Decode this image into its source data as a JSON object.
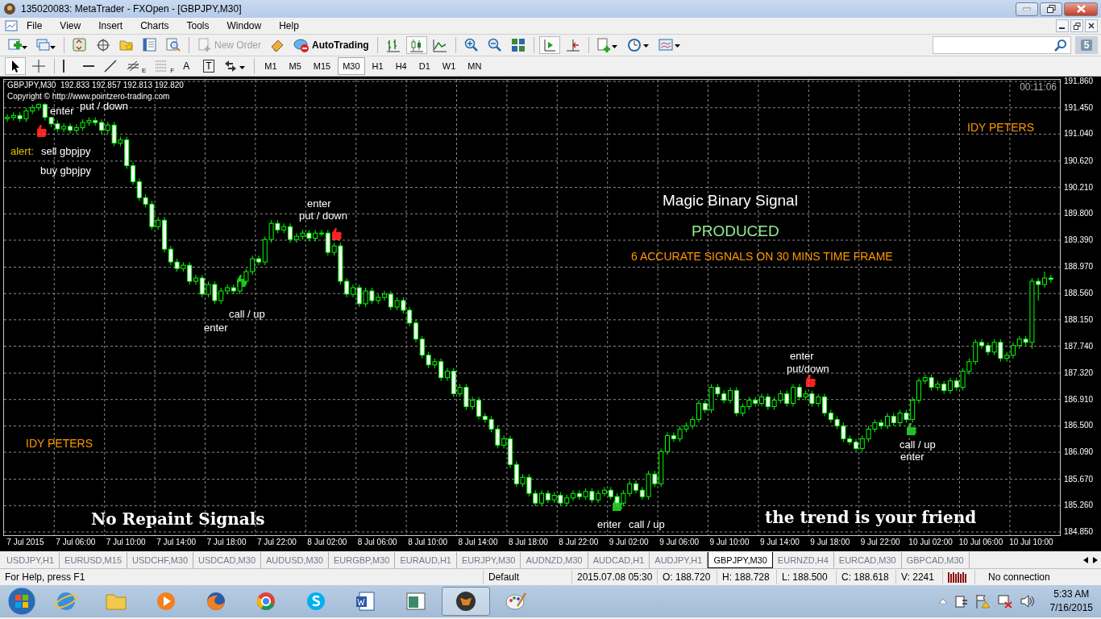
{
  "window": {
    "title": "135020083: MetaTrader - FXOpen - [GBPJPY,M30]"
  },
  "menu": [
    "File",
    "View",
    "Insert",
    "Charts",
    "Tools",
    "Window",
    "Help"
  ],
  "toolbar_1": [
    {
      "kind": "new-chart"
    },
    {
      "kind": "profiles"
    },
    {
      "kind": "separator"
    },
    {
      "kind": "market-watch"
    },
    {
      "kind": "navigator"
    },
    {
      "kind": "favorites"
    },
    {
      "kind": "terminal"
    },
    {
      "kind": "tester"
    },
    {
      "kind": "separator"
    },
    {
      "kind": "new-order",
      "label": "New Order",
      "disabled": true
    },
    {
      "kind": "editor"
    },
    {
      "kind": "autotrading",
      "label": "AutoTrading",
      "disabled": false
    },
    {
      "kind": "separator"
    },
    {
      "kind": "bar-chart",
      "selected": false
    },
    {
      "kind": "candles",
      "selected": true
    },
    {
      "kind": "line-chart",
      "selected": false
    },
    {
      "kind": "separator"
    },
    {
      "kind": "zoom-in"
    },
    {
      "kind": "zoom-out"
    },
    {
      "kind": "tile"
    },
    {
      "kind": "separator"
    },
    {
      "kind": "auto-scroll",
      "selected": true
    },
    {
      "kind": "chart-shift",
      "selected": false
    },
    {
      "kind": "separator"
    },
    {
      "kind": "indicators"
    },
    {
      "kind": "periods"
    },
    {
      "kind": "templates"
    }
  ],
  "messages_badge": "5",
  "toolbar_2": [
    {
      "kind": "cursor",
      "selected": true
    },
    {
      "kind": "crosshair",
      "selected": false
    },
    {
      "kind": "separator"
    },
    {
      "kind": "vline",
      "selected": false
    },
    {
      "kind": "hline",
      "selected": false
    },
    {
      "kind": "trendline",
      "selected": false
    },
    {
      "kind": "fib-channel",
      "label": "E",
      "selected": false
    },
    {
      "kind": "fib",
      "label": "F",
      "selected": false
    },
    {
      "kind": "text",
      "label": "A",
      "selected": false
    },
    {
      "kind": "label",
      "label": "T",
      "selected": false
    },
    {
      "kind": "arrows",
      "selected": false
    }
  ],
  "periods": [
    {
      "label": "M1",
      "selected": false
    },
    {
      "label": "M5",
      "selected": false
    },
    {
      "label": "M15",
      "selected": false
    },
    {
      "label": "M30",
      "selected": true
    },
    {
      "label": "H1",
      "selected": false
    },
    {
      "label": "H4",
      "selected": false
    },
    {
      "label": "D1",
      "selected": false
    },
    {
      "label": "W1",
      "selected": false
    },
    {
      "label": "MN",
      "selected": false
    }
  ],
  "chart": {
    "header": "GBPJPY,M30  192.833 192.857 192.813 192.820",
    "copyright": "Copyright © http://www.pointzero-trading.com",
    "timer": "00:11:06",
    "annotations": [
      {
        "text": "enter",
        "kind": "note"
      },
      {
        "text": "put / down",
        "kind": "note"
      },
      {
        "text": "alert:",
        "kind": "alert"
      },
      {
        "text": "sell gbpjpy",
        "kind": "note"
      },
      {
        "text": "buy gbpjpy",
        "kind": "note"
      },
      {
        "text": "IDY PETERS",
        "kind": "brand"
      },
      {
        "text": "Magic Binary Signal",
        "kind": "title"
      },
      {
        "text": "PRODUCED",
        "kind": "subtitle"
      },
      {
        "text": "6 ACCURATE SIGNALS ON 30 MINS TIME FRAME",
        "kind": "banner"
      },
      {
        "text": "enter",
        "kind": "note"
      },
      {
        "text": "put / down",
        "kind": "note"
      },
      {
        "text": "call / up",
        "kind": "note"
      },
      {
        "text": "enter",
        "kind": "note"
      },
      {
        "text": "enter",
        "kind": "note"
      },
      {
        "text": "put/down",
        "kind": "note"
      },
      {
        "text": "call / up",
        "kind": "note"
      },
      {
        "text": "enter",
        "kind": "note"
      },
      {
        "text": "IDY PETERS",
        "kind": "brand"
      },
      {
        "text": "No Repaint Signals",
        "kind": "slogan"
      },
      {
        "text": "enter",
        "kind": "note"
      },
      {
        "text": "call / up",
        "kind": "note"
      },
      {
        "text": "the trend is your friend",
        "kind": "slogan"
      }
    ],
    "markers": [
      {
        "color": "#ff2020"
      },
      {
        "color": "#ff2020"
      },
      {
        "color": "#ff2020"
      },
      {
        "color": "#20c020"
      },
      {
        "color": "#20c020"
      },
      {
        "color": "#20c020"
      }
    ],
    "chart_data": {
      "type": "candlestick",
      "grid": true,
      "ylim": [
        184.85,
        191.86
      ],
      "categories": [
        null,
        null,
        null,
        "7 Jul 2015",
        null,
        null,
        null,
        null,
        null,
        null,
        null,
        "7 Jul 06:00",
        null,
        null,
        null,
        null,
        null,
        null,
        null,
        "7 Jul 10:00",
        null,
        null,
        null,
        null,
        null,
        null,
        null,
        "7 Jul 14:00",
        null,
        null,
        null,
        null,
        null,
        null,
        null,
        "7 Jul 18:00",
        null,
        null,
        null,
        null,
        null,
        null,
        null,
        "7 Jul 22:00",
        null,
        null,
        null,
        null,
        null,
        null,
        null,
        "8 Jul 02:00",
        null,
        null,
        null,
        null,
        null,
        null,
        null,
        "8 Jul 06:00",
        null,
        null,
        null,
        null,
        null,
        null,
        null,
        "8 Jul 10:00",
        null,
        null,
        null,
        null,
        null,
        null,
        null,
        "8 Jul 14:00",
        null,
        null,
        null,
        null,
        null,
        null,
        null,
        "8 Jul 18:00",
        null,
        null,
        null,
        null,
        null,
        null,
        null,
        "8 Jul 22:00",
        null,
        null,
        null,
        null,
        null,
        null,
        null,
        "9 Jul 02:00",
        null,
        null,
        null,
        null,
        null,
        null,
        null,
        "9 Jul 06:00",
        null,
        null,
        null,
        null,
        null,
        null,
        null,
        "9 Jul 10:00",
        null,
        null,
        null,
        null,
        null,
        null,
        null,
        "9 Jul 14:00",
        null,
        null,
        null,
        null,
        null,
        null,
        null,
        "9 Jul 18:00",
        null,
        null,
        null,
        null,
        null,
        null,
        null,
        "9 Jul 22:00",
        null,
        null,
        null,
        null,
        null,
        null,
        null,
        "10 Jul 02:00",
        null,
        null,
        null,
        null,
        null,
        null,
        null,
        "10 Jul 06:00",
        null,
        null,
        null,
        null,
        null,
        null,
        null,
        "10 Jul 10:00",
        null,
        null,
        null
      ],
      "yticks": [
        {
          "value": 191.86,
          "label": "191.860"
        },
        {
          "value": 191.45,
          "label": "191.450"
        },
        {
          "value": 191.04,
          "label": "191.040"
        },
        {
          "value": 190.62,
          "label": "190.620"
        },
        {
          "value": 190.21,
          "label": "190.210"
        },
        {
          "value": 189.8,
          "label": "189.800"
        },
        {
          "value": 189.39,
          "label": "189.390"
        },
        {
          "value": 188.97,
          "label": "188.970"
        },
        {
          "value": 188.56,
          "label": "188.560"
        },
        {
          "value": 188.15,
          "label": "188.150"
        },
        {
          "value": 187.74,
          "label": "187.740"
        },
        {
          "value": 187.32,
          "label": "187.320"
        },
        {
          "value": 186.91,
          "label": "186.910"
        },
        {
          "value": 186.5,
          "label": "186.500"
        },
        {
          "value": 186.09,
          "label": "186.090"
        },
        {
          "value": 185.67,
          "label": "185.670"
        },
        {
          "value": 185.26,
          "label": "185.260"
        },
        {
          "value": 184.85,
          "label": "184.850"
        }
      ],
      "ohlc": [
        [
          191.28,
          191.35,
          191.23,
          191.3
        ],
        [
          191.3,
          191.38,
          191.25,
          191.33
        ],
        [
          191.33,
          191.38,
          191.23,
          191.28
        ],
        [
          191.28,
          191.45,
          191.23,
          191.4
        ],
        [
          191.4,
          191.5,
          191.35,
          191.45
        ],
        [
          191.45,
          191.52,
          191.4,
          191.5
        ],
        [
          191.5,
          191.52,
          191.25,
          191.3
        ],
        [
          191.3,
          191.3,
          191.15,
          191.2
        ],
        [
          191.2,
          191.25,
          191.07,
          191.12
        ],
        [
          191.12,
          191.21,
          191.07,
          191.16
        ],
        [
          191.16,
          191.21,
          191.05,
          191.1
        ],
        [
          191.1,
          191.19,
          191.05,
          191.14
        ],
        [
          191.14,
          191.27,
          191.09,
          191.22
        ],
        [
          191.22,
          191.3,
          191.17,
          191.25
        ],
        [
          191.25,
          191.3,
          191.17,
          191.22
        ],
        [
          191.22,
          191.27,
          191.05,
          191.1
        ],
        [
          191.1,
          191.23,
          191.05,
          191.18
        ],
        [
          191.18,
          191.23,
          190.85,
          190.9
        ],
        [
          190.9,
          191.0,
          190.85,
          190.95
        ],
        [
          190.95,
          191.0,
          190.5,
          190.55
        ],
        [
          190.55,
          190.6,
          190.25,
          190.3
        ],
        [
          190.3,
          190.35,
          190.0,
          190.05
        ],
        [
          190.05,
          190.1,
          189.9,
          189.95
        ],
        [
          189.95,
          190.0,
          189.55,
          189.6
        ],
        [
          189.6,
          189.75,
          189.55,
          189.7
        ],
        [
          189.7,
          189.75,
          189.2,
          189.25
        ],
        [
          189.25,
          189.3,
          189.0,
          189.05
        ],
        [
          189.05,
          189.1,
          188.9,
          188.95
        ],
        [
          188.95,
          189.05,
          188.9,
          189.0
        ],
        [
          189.0,
          189.05,
          188.7,
          188.75
        ],
        [
          188.75,
          188.85,
          188.7,
          188.8
        ],
        [
          188.8,
          188.85,
          188.5,
          188.55
        ],
        [
          188.55,
          188.75,
          188.5,
          188.7
        ],
        [
          188.7,
          188.75,
          188.4,
          188.45
        ],
        [
          188.45,
          188.65,
          188.4,
          188.6
        ],
        [
          188.6,
          188.7,
          188.55,
          188.65
        ],
        [
          188.65,
          188.7,
          188.55,
          188.6
        ],
        [
          188.6,
          188.8,
          188.55,
          188.75
        ],
        [
          188.75,
          188.95,
          188.7,
          188.9
        ],
        [
          188.9,
          189.15,
          188.85,
          189.1
        ],
        [
          189.1,
          189.15,
          189.0,
          189.05
        ],
        [
          189.05,
          189.45,
          189.0,
          189.4
        ],
        [
          189.4,
          189.7,
          189.35,
          189.65
        ],
        [
          189.65,
          189.7,
          189.5,
          189.55
        ],
        [
          189.55,
          189.65,
          189.5,
          189.6
        ],
        [
          189.6,
          189.65,
          189.35,
          189.4
        ],
        [
          189.4,
          189.5,
          189.35,
          189.45
        ],
        [
          189.45,
          189.55,
          189.4,
          189.5
        ],
        [
          189.5,
          189.55,
          189.37,
          189.42
        ],
        [
          189.42,
          189.55,
          189.37,
          189.5
        ],
        [
          189.5,
          189.55,
          189.45,
          189.5
        ],
        [
          189.5,
          189.55,
          189.15,
          189.2
        ],
        [
          189.2,
          189.35,
          189.15,
          189.3
        ],
        [
          189.3,
          189.35,
          188.7,
          188.75
        ],
        [
          188.75,
          188.8,
          188.5,
          188.55
        ],
        [
          188.55,
          188.7,
          188.5,
          188.65
        ],
        [
          188.65,
          188.7,
          188.35,
          188.4
        ],
        [
          188.4,
          188.65,
          188.35,
          188.6
        ],
        [
          188.6,
          188.65,
          188.4,
          188.45
        ],
        [
          188.45,
          188.55,
          188.4,
          188.5
        ],
        [
          188.5,
          188.6,
          188.45,
          188.55
        ],
        [
          188.55,
          188.6,
          188.3,
          188.35
        ],
        [
          188.35,
          188.5,
          188.3,
          188.45
        ],
        [
          188.45,
          188.5,
          188.25,
          188.3
        ],
        [
          188.3,
          188.35,
          188.05,
          188.1
        ],
        [
          188.1,
          188.15,
          187.8,
          187.85
        ],
        [
          187.85,
          187.9,
          187.55,
          187.6
        ],
        [
          187.6,
          187.65,
          187.4,
          187.45
        ],
        [
          187.45,
          187.55,
          187.4,
          187.5
        ],
        [
          187.5,
          187.55,
          187.2,
          187.25
        ],
        [
          187.25,
          187.4,
          187.2,
          187.35
        ],
        [
          187.35,
          187.4,
          186.95,
          187.0
        ],
        [
          187.0,
          187.15,
          186.95,
          187.1
        ],
        [
          187.1,
          187.15,
          186.75,
          186.8
        ],
        [
          186.8,
          186.95,
          186.75,
          186.9
        ],
        [
          186.9,
          186.95,
          186.6,
          186.65
        ],
        [
          186.65,
          186.7,
          186.55,
          186.6
        ],
        [
          186.6,
          186.65,
          186.4,
          186.45
        ],
        [
          186.45,
          186.5,
          186.15,
          186.2
        ],
        [
          186.2,
          186.35,
          186.15,
          186.3
        ],
        [
          186.3,
          186.35,
          185.85,
          185.9
        ],
        [
          185.9,
          185.95,
          185.55,
          185.6
        ],
        [
          185.6,
          185.75,
          185.55,
          185.7
        ],
        [
          185.7,
          185.75,
          185.4,
          185.45
        ],
        [
          185.45,
          185.5,
          185.25,
          185.3
        ],
        [
          185.3,
          185.5,
          185.25,
          185.45
        ],
        [
          185.45,
          185.5,
          185.3,
          185.35
        ],
        [
          185.35,
          185.47,
          185.3,
          185.42
        ],
        [
          185.42,
          185.47,
          185.25,
          185.3
        ],
        [
          185.3,
          185.43,
          185.25,
          185.38
        ],
        [
          185.38,
          185.5,
          185.33,
          185.45
        ],
        [
          185.45,
          185.5,
          185.35,
          185.4
        ],
        [
          185.4,
          185.53,
          185.35,
          185.48
        ],
        [
          185.48,
          185.53,
          185.3,
          185.35
        ],
        [
          185.35,
          185.5,
          185.3,
          185.45
        ],
        [
          185.45,
          185.55,
          185.4,
          185.5
        ],
        [
          185.5,
          185.55,
          185.35,
          185.4
        ],
        [
          185.4,
          185.45,
          185.25,
          185.3
        ],
        [
          185.3,
          185.5,
          185.25,
          185.45
        ],
        [
          185.45,
          185.65,
          185.4,
          185.6
        ],
        [
          185.6,
          185.65,
          185.45,
          185.5
        ],
        [
          185.5,
          185.55,
          185.35,
          185.4
        ],
        [
          185.4,
          185.8,
          185.35,
          185.75
        ],
        [
          185.75,
          185.8,
          185.55,
          185.6
        ],
        [
          185.6,
          186.15,
          185.55,
          186.1
        ],
        [
          186.1,
          186.4,
          186.05,
          186.35
        ],
        [
          186.35,
          186.4,
          186.25,
          186.3
        ],
        [
          186.3,
          186.5,
          186.25,
          186.45
        ],
        [
          186.45,
          186.55,
          186.4,
          186.5
        ],
        [
          186.5,
          186.65,
          186.45,
          186.6
        ],
        [
          186.6,
          186.9,
          186.55,
          186.85
        ],
        [
          186.85,
          186.9,
          186.7,
          186.75
        ],
        [
          186.75,
          187.15,
          186.7,
          187.1
        ],
        [
          187.1,
          187.15,
          186.95,
          187.0
        ],
        [
          187.0,
          187.05,
          186.85,
          186.9
        ],
        [
          186.9,
          187.1,
          186.85,
          187.05
        ],
        [
          187.05,
          187.1,
          186.65,
          186.7
        ],
        [
          186.7,
          186.85,
          186.65,
          186.8
        ],
        [
          186.8,
          186.95,
          186.75,
          186.9
        ],
        [
          186.9,
          186.95,
          186.8,
          186.85
        ],
        [
          186.85,
          187.0,
          186.8,
          186.95
        ],
        [
          186.95,
          187.0,
          186.75,
          186.8
        ],
        [
          186.8,
          186.95,
          186.75,
          186.9
        ],
        [
          186.9,
          187.05,
          186.85,
          187.0
        ],
        [
          187.0,
          187.05,
          186.8,
          186.85
        ],
        [
          186.85,
          187.15,
          186.8,
          187.1
        ],
        [
          187.1,
          187.15,
          186.9,
          186.95
        ],
        [
          186.95,
          187.05,
          186.9,
          187.0
        ],
        [
          187.0,
          187.05,
          186.8,
          186.85
        ],
        [
          186.85,
          187.0,
          186.8,
          186.95
        ],
        [
          186.95,
          187.0,
          186.65,
          186.7
        ],
        [
          186.7,
          186.75,
          186.55,
          186.6
        ],
        [
          186.6,
          186.65,
          186.45,
          186.5
        ],
        [
          186.5,
          186.55,
          186.25,
          186.3
        ],
        [
          186.3,
          186.35,
          186.2,
          186.25
        ],
        [
          186.25,
          186.3,
          186.1,
          186.15
        ],
        [
          186.15,
          186.35,
          186.1,
          186.3
        ],
        [
          186.3,
          186.5,
          186.25,
          186.45
        ],
        [
          186.45,
          186.6,
          186.4,
          186.55
        ],
        [
          186.55,
          186.6,
          186.45,
          186.5
        ],
        [
          186.5,
          186.7,
          186.45,
          186.65
        ],
        [
          186.65,
          186.7,
          186.5,
          186.55
        ],
        [
          186.55,
          186.75,
          186.5,
          186.7
        ],
        [
          186.7,
          186.75,
          186.55,
          186.6
        ],
        [
          186.6,
          186.95,
          186.55,
          186.9
        ],
        [
          186.9,
          187.25,
          186.85,
          187.2
        ],
        [
          187.2,
          187.3,
          187.15,
          187.25
        ],
        [
          187.25,
          187.3,
          187.05,
          187.1
        ],
        [
          187.1,
          187.2,
          187.05,
          187.15
        ],
        [
          187.15,
          187.2,
          187.0,
          187.05
        ],
        [
          187.05,
          187.25,
          187.0,
          187.2
        ],
        [
          187.2,
          187.25,
          187.05,
          187.1
        ],
        [
          187.1,
          187.4,
          187.05,
          187.35
        ],
        [
          187.35,
          187.55,
          187.3,
          187.5
        ],
        [
          187.5,
          187.85,
          187.45,
          187.8
        ],
        [
          187.8,
          187.85,
          187.7,
          187.75
        ],
        [
          187.75,
          187.8,
          187.6,
          187.65
        ],
        [
          187.65,
          187.85,
          187.6,
          187.8
        ],
        [
          187.8,
          187.85,
          187.5,
          187.55
        ],
        [
          187.55,
          187.65,
          187.5,
          187.6
        ],
        [
          187.6,
          187.8,
          187.55,
          187.75
        ],
        [
          187.75,
          187.9,
          187.7,
          187.85
        ],
        [
          187.85,
          187.9,
          187.75,
          187.8
        ],
        [
          187.8,
          188.8,
          187.7,
          188.75
        ],
        [
          188.75,
          188.8,
          188.45,
          188.7
        ],
        [
          188.7,
          188.9,
          188.65,
          188.8
        ],
        [
          188.8,
          188.85,
          188.73,
          188.78
        ]
      ]
    }
  },
  "chart_tabs": [
    {
      "label": "USDJPY,H1",
      "selected": false
    },
    {
      "label": "EURUSD,M15",
      "selected": false
    },
    {
      "label": "USDCHF,M30",
      "selected": false
    },
    {
      "label": "USDCAD,M30",
      "selected": false
    },
    {
      "label": "AUDUSD,M30",
      "selected": false
    },
    {
      "label": "EURGBP,M30",
      "selected": false
    },
    {
      "label": "EURAUD,H1",
      "selected": false
    },
    {
      "label": "EURJPY,M30",
      "selected": false
    },
    {
      "label": "AUDNZD,M30",
      "selected": false
    },
    {
      "label": "AUDCAD,H1",
      "selected": false
    },
    {
      "label": "AUDJPY,H1",
      "selected": false
    },
    {
      "label": "GBPJPY,M30",
      "selected": true
    },
    {
      "label": "EURNZD,H4",
      "selected": false
    },
    {
      "label": "EURCAD,M30",
      "selected": false
    },
    {
      "label": "GBPCAD,M30",
      "selected": false
    }
  ],
  "status_bar": {
    "help": "For Help, press F1",
    "profile": "Default",
    "time": "2015.07.08 05:30",
    "open": "O: 188.720",
    "high": "H: 188.728",
    "low": "L: 188.500",
    "close": "C: 188.618",
    "volume": "V: 2241",
    "connection": "No connection"
  },
  "taskbar": {
    "apps": [
      {
        "kind": "ie",
        "selected": false
      },
      {
        "kind": "folder",
        "selected": false
      },
      {
        "kind": "media",
        "selected": false
      },
      {
        "kind": "firefox",
        "selected": false
      },
      {
        "kind": "chrome",
        "selected": false
      },
      {
        "kind": "skype",
        "selected": false
      },
      {
        "kind": "word",
        "selected": false
      },
      {
        "kind": "window",
        "selected": false
      },
      {
        "kind": "bull",
        "selected": true
      },
      {
        "kind": "paint",
        "selected": false
      }
    ],
    "time": "5:33 AM",
    "date": "7/16/2015"
  }
}
